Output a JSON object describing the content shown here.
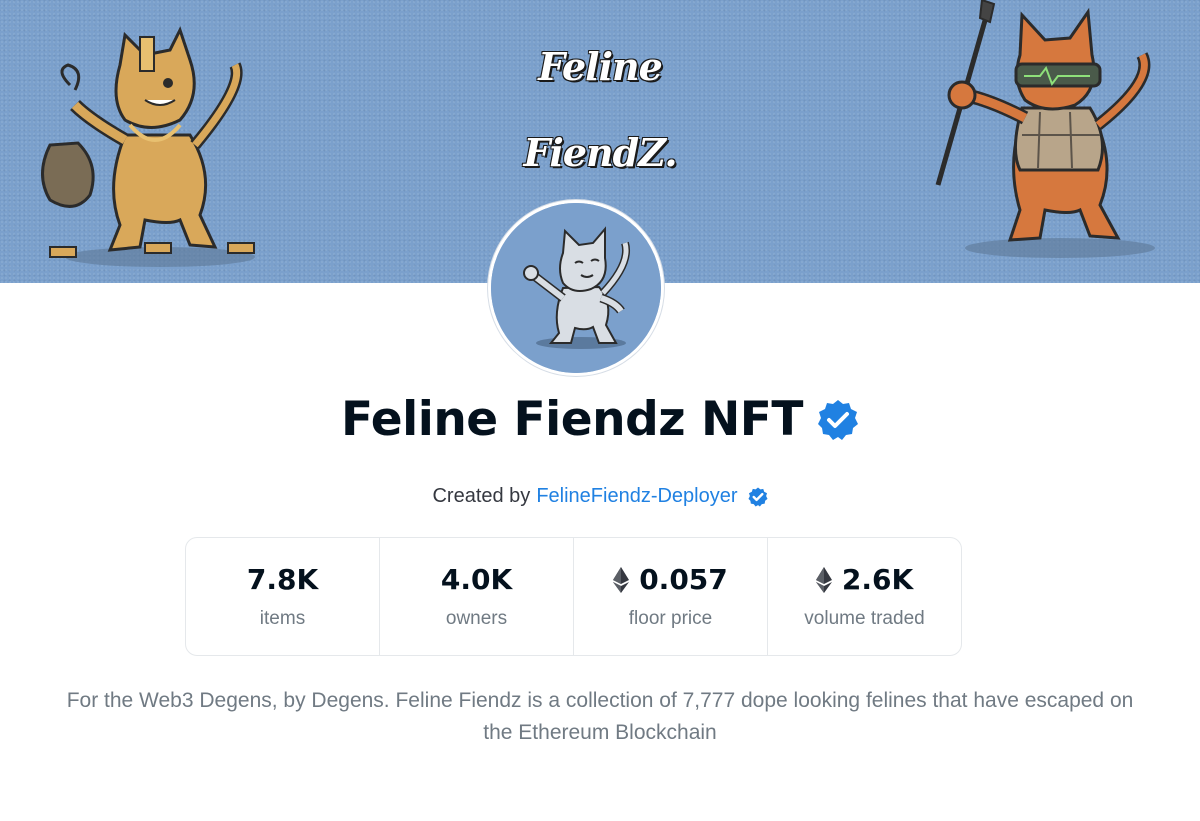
{
  "banner": {
    "title_line1": "Feline",
    "title_line2": "FiendZ."
  },
  "collection": {
    "name": "Feline Fiendz NFT",
    "created_by_label": "Created by",
    "creator": "FelineFiendz-Deployer",
    "verified": true
  },
  "stats": [
    {
      "value": "7.8K",
      "label": "items",
      "icon": null
    },
    {
      "value": "4.0K",
      "label": "owners",
      "icon": null
    },
    {
      "value": "0.057",
      "label": "floor price",
      "icon": "eth-icon"
    },
    {
      "value": "2.6K",
      "label": "volume traded",
      "icon": "eth-icon"
    }
  ],
  "description": "For the Web3 Degens, by Degens. Feline Fiendz is a collection of 7,777 dope looking felines that have escaped on the Ethereum Blockchain",
  "colors": {
    "banner_bg": "#7ba0cc",
    "verified_blue": "#2081e2",
    "text_primary": "#04111d",
    "text_secondary": "#707a83"
  }
}
